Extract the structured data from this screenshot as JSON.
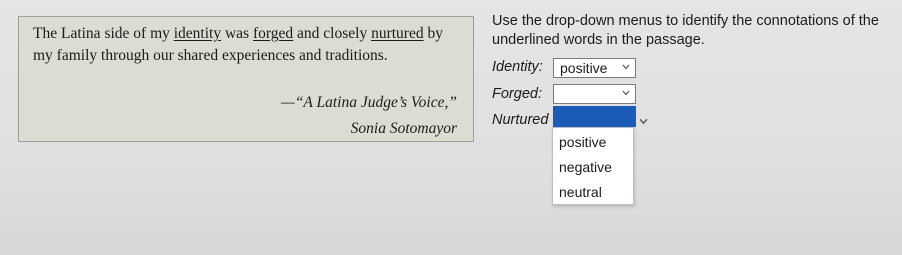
{
  "passage": {
    "w1": "The Latina side of my ",
    "identity": "identity",
    "w2": " was ",
    "forged": "forged",
    "w3": " and closely ",
    "nurtured": "nurtured",
    "w4": " by my family through our shared experiences and traditions.",
    "attribution_title": "—“A Latina Judge’s Voice,”",
    "attribution_author": "Sonia Sotomayor"
  },
  "question": {
    "instructions": "Use the drop-down menus to identify the connotations of the underlined words in the passage.",
    "rows": [
      {
        "label": "Identity:",
        "selected": "positive"
      },
      {
        "label": "Forged:",
        "selected": ""
      },
      {
        "label": "Nurtured",
        "selected": ""
      }
    ],
    "options": [
      "positive",
      "negative",
      "neutral"
    ]
  },
  "colors": {
    "highlight": "#1a5cb8",
    "passage_bg": "#dbdcd2"
  }
}
